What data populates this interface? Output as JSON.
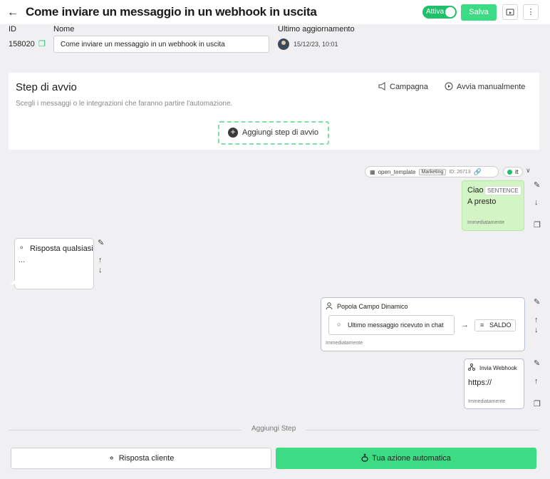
{
  "header": {
    "title": "Come inviare un messaggio in un webhook in uscita",
    "toggle_label": "Attiva",
    "save_label": "Salva",
    "colors": {
      "accent": "#3ddc84",
      "toggle": "#20c06a"
    }
  },
  "details": {
    "id_label": "ID",
    "id_value": "158020",
    "name_label": "Nome",
    "name_value": "Come inviare un messaggio in un webhook in uscita",
    "updated_label": "Ultimo aggiornamento",
    "updated_value": "15/12/23, 10:01"
  },
  "start": {
    "title": "Step di avvio",
    "subtitle": "Scegli i messaggi o le integrazioni che faranno partire l'automazione.",
    "campaign_label": "Campagna",
    "manual_label": "Avvia manualmente",
    "add_label": "Aggiungi step di avvio"
  },
  "template": {
    "name": "open_template",
    "tag": "Marketing",
    "id": "ID: 26713",
    "lang": "it"
  },
  "message": {
    "line1": "Ciao",
    "sentence_tag": "SENTENCE",
    "line2": "A presto",
    "timing": "Immediatamente"
  },
  "response": {
    "label": "Risposta qualsiasi",
    "dots": "..."
  },
  "popola": {
    "title": "Popola Campo Dinamico",
    "source": "Ultimo messaggio ricevuto in chat",
    "target": "SALDO",
    "timing": "Immediatamente"
  },
  "webhook": {
    "title": "Invia Webhook",
    "url": "https://",
    "timing": "Immediatamente"
  },
  "footer": {
    "add_step_label": "Aggiungi Step",
    "customer_response_label": "Risposta cliente",
    "auto_action_label": "Tua azione automatica"
  }
}
